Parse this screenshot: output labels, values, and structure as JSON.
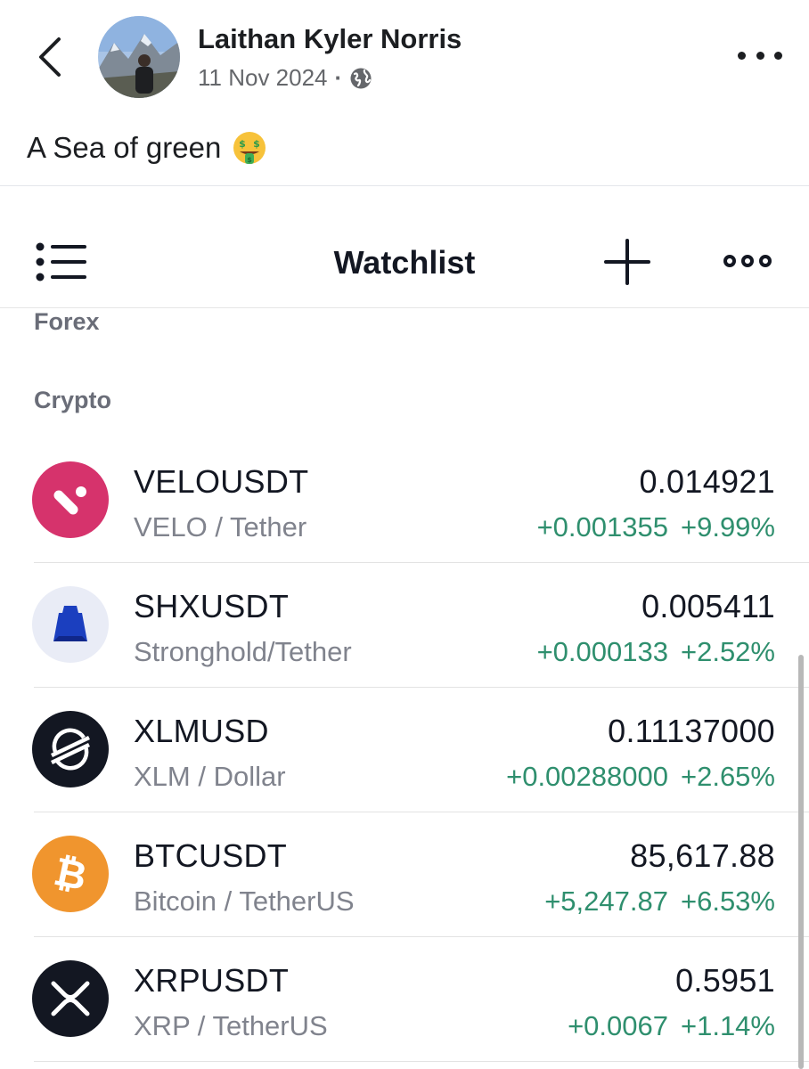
{
  "post": {
    "author": "Laithan Kyler Norris",
    "date": "11 Nov 2024",
    "separator": "·",
    "audience_icon": "globe-icon",
    "caption": "A Sea of green",
    "caption_emoji": "money-mouth-face-emoji"
  },
  "watchlist": {
    "title": "Watchlist",
    "sections": {
      "forex": "Forex",
      "crypto": "Crypto"
    },
    "items": [
      {
        "symbol": "VELOUSDT",
        "description": "VELO / Tether",
        "price": "0.014921",
        "change": "+0.001355",
        "change_pct": "+9.99%",
        "icon": "velo-logo-icon",
        "icon_color": "#d6336c"
      },
      {
        "symbol": "SHXUSDT",
        "description": "Stronghold/Tether",
        "price": "0.005411",
        "change": "+0.000133",
        "change_pct": "+2.52%",
        "icon": "stronghold-logo-icon",
        "icon_color": "#1b3fbf"
      },
      {
        "symbol": "XLMUSD",
        "description": "XLM / Dollar",
        "price": "0.11137000",
        "change": "+0.00288000",
        "change_pct": "+2.65%",
        "icon": "stellar-logo-icon",
        "icon_color": "#131722"
      },
      {
        "symbol": "BTCUSDT",
        "description": "Bitcoin / TetherUS",
        "price": "85,617.88",
        "change": "+5,247.87",
        "change_pct": "+6.53%",
        "icon": "bitcoin-logo-icon",
        "icon_color": "#f0952e"
      },
      {
        "symbol": "XRPUSDT",
        "description": "XRP / TetherUS",
        "price": "0.5951",
        "change": "+0.0067",
        "change_pct": "+1.14%",
        "icon": "xrp-logo-icon",
        "icon_color": "#131722"
      }
    ]
  },
  "colors": {
    "positive_change": "#2f8f6e",
    "muted_text": "#80838d"
  }
}
